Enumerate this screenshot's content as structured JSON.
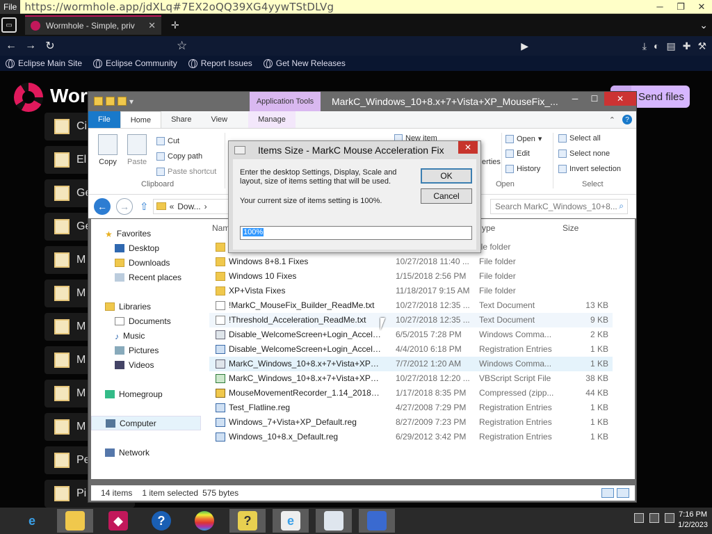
{
  "browser": {
    "file_tab": "File",
    "url": "https://wormhole.app/jdXLq#7EX2oQQ39XG4yywTStDLVg",
    "tab_title": "Wormhole - Simple, priv",
    "bookmarks": [
      "Eclipse Main Site",
      "Eclipse Community",
      "Report Issues",
      "Get New Releases"
    ]
  },
  "page": {
    "title": "Worm",
    "send_files": "Send files",
    "bg_rows": [
      "Ci",
      "El",
      "Ge",
      "Ge",
      "M",
      "M",
      "M",
      "M",
      "M",
      "M",
      "Pe",
      "Pi"
    ]
  },
  "explorer": {
    "app_tools": "Application Tools",
    "caption": "MarkC_Windows_10+8.x+7+Vista+XP_MouseFix_...",
    "tabs": {
      "file": "File",
      "home": "Home",
      "share": "Share",
      "view": "View",
      "manage": "Manage"
    },
    "ribbon": {
      "copy": "Copy",
      "paste": "Paste",
      "cut": "Cut",
      "copy_path": "Copy path",
      "paste_shortcut": "Paste shortcut",
      "clipboard": "Clipboard",
      "new_item": "New item",
      "properties": "erties",
      "open": "Open",
      "edit": "Edit",
      "history": "History",
      "open_group": "Open",
      "select_all": "Select all",
      "select_none": "Select none",
      "invert_selection": "Invert selection",
      "select_group": "Select"
    },
    "address": "Dow...",
    "address_prefix": "«",
    "search_placeholder": "Search MarkC_Windows_10+8...",
    "columns": {
      "name": "Nam",
      "type": "ype",
      "size": "Size"
    },
    "nav": {
      "favorites": "Favorites",
      "desktop": "Desktop",
      "downloads": "Downloads",
      "recent": "Recent places",
      "libraries": "Libraries",
      "documents": "Documents",
      "music": "Music",
      "pictures": "Pictures",
      "videos": "Videos",
      "homegroup": "Homegroup",
      "computer": "Computer",
      "network": "Network"
    },
    "files": [
      {
        "name": "",
        "date": "",
        "type": "ile folder",
        "size": "",
        "icon": "folder"
      },
      {
        "name": "Windows 8+8.1 Fixes",
        "date": "10/27/2018 11:40 ...",
        "type": "File folder",
        "size": "",
        "icon": "folder"
      },
      {
        "name": "Windows 10 Fixes",
        "date": "1/15/2018 2:56 PM",
        "type": "File folder",
        "size": "",
        "icon": "folder"
      },
      {
        "name": "XP+Vista Fixes",
        "date": "11/18/2017 9:15 AM",
        "type": "File folder",
        "size": "",
        "icon": "folder"
      },
      {
        "name": "!MarkC_MouseFix_Builder_ReadMe.txt",
        "date": "10/27/2018 12:35 ...",
        "type": "Text Document",
        "size": "13 KB",
        "icon": "txt"
      },
      {
        "name": "!Threshold_Acceleration_ReadMe.txt",
        "date": "10/27/2018 12:35 ...",
        "type": "Text Document",
        "size": "9 KB",
        "icon": "txt"
      },
      {
        "name": "Disable_WelcomeScreen+Login_Accel.c...",
        "date": "6/5/2015 7:28 PM",
        "type": "Windows Comma...",
        "size": "2 KB",
        "icon": "cmd"
      },
      {
        "name": "Disable_WelcomeScreen+Login_Accel.reg",
        "date": "4/4/2010 6:18 PM",
        "type": "Registration Entries",
        "size": "1 KB",
        "icon": "reg"
      },
      {
        "name": "MarkC_Windows_10+8.x+7+Vista+XP_M...",
        "date": "7/7/2012 1:20 AM",
        "type": "Windows Comma...",
        "size": "1 KB",
        "icon": "cmd"
      },
      {
        "name": "MarkC_Windows_10+8.x+7+Vista+XP_M...",
        "date": "10/27/2018 12:20 ...",
        "type": "VBScript Script File",
        "size": "38 KB",
        "icon": "vbs"
      },
      {
        "name": "MouseMovementRecorder_1.14_2018011...",
        "date": "1/17/2018 8:35 PM",
        "type": "Compressed (zipp...",
        "size": "44 KB",
        "icon": "zip"
      },
      {
        "name": "Test_Flatline.reg",
        "date": "4/27/2008 7:29 PM",
        "type": "Registration Entries",
        "size": "1 KB",
        "icon": "reg"
      },
      {
        "name": "Windows_7+Vista+XP_Default.reg",
        "date": "8/27/2009 7:23 PM",
        "type": "Registration Entries",
        "size": "1 KB",
        "icon": "reg"
      },
      {
        "name": "Windows_10+8.x_Default.reg",
        "date": "6/29/2012 3:42 PM",
        "type": "Registration Entries",
        "size": "1 KB",
        "icon": "reg"
      }
    ],
    "status": {
      "items": "14 items",
      "selected": "1 item selected",
      "bytes": "575 bytes"
    }
  },
  "dialog": {
    "title": "Items Size - MarkC Mouse Acceleration Fix",
    "message": "Enter the desktop Settings, Display, Scale and layout, size of items setting that will be used.",
    "current": "Your current size of items setting is 100%.",
    "ok": "OK",
    "cancel": "Cancel",
    "input_value": "100%"
  },
  "taskbar": {
    "time": "7:16 PM",
    "date": "1/2/2023"
  }
}
